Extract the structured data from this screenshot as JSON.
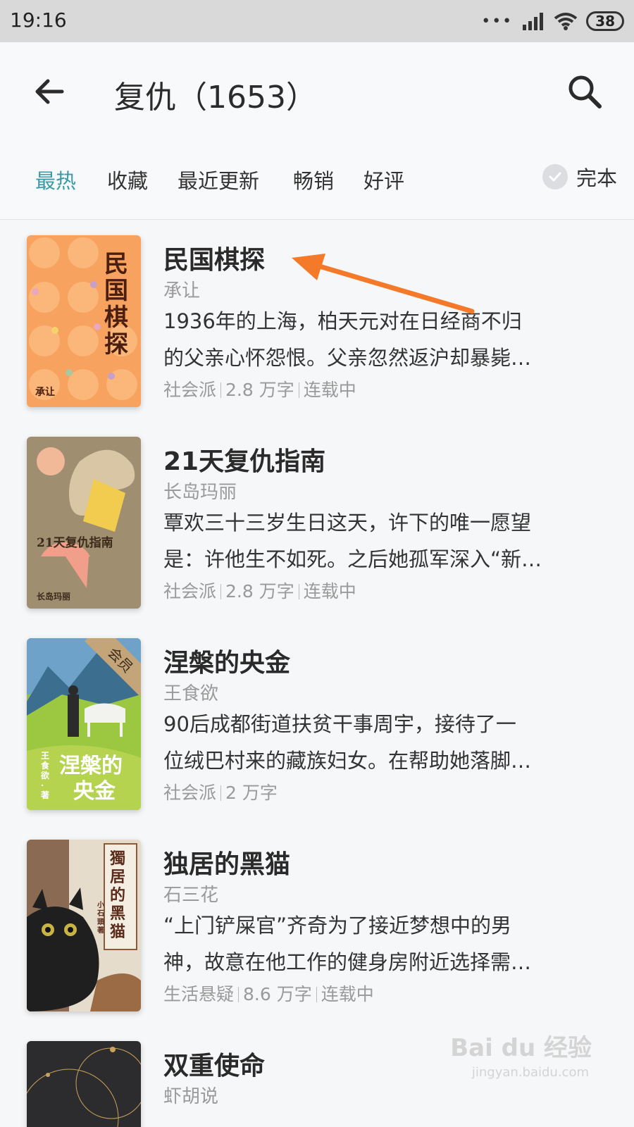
{
  "status_bar": {
    "time": "19:16",
    "battery": "38",
    "signal_icon": "signal-icon",
    "wifi_icon": "wifi-icon"
  },
  "header": {
    "title": "复仇（1653）",
    "back_icon": "back-arrow-icon",
    "search_icon": "search-icon"
  },
  "filters": {
    "tabs": [
      {
        "label": "最热",
        "active": true
      },
      {
        "label": "收藏",
        "active": false
      },
      {
        "label": "最近更新",
        "active": false
      },
      {
        "label": "畅销",
        "active": false
      },
      {
        "label": "好评",
        "active": false
      }
    ],
    "complete_label": "完本",
    "accent_color": "#3a9aa8"
  },
  "books": [
    {
      "title": "民国棋探",
      "author": "承让",
      "desc_line1": "1936年的上海，柏天元对在日经商不归",
      "desc_line2": "的父亲心怀怨恨。父亲忽然返沪却暴毙…",
      "genre": "社会派",
      "words": "2.8 万字",
      "status": "连载中",
      "cover_title": "民国棋探",
      "cover_author": "承让"
    },
    {
      "title": "21天复仇指南",
      "author": "长岛玛丽",
      "desc_line1": "覃欢三十三岁生日这天，许下的唯一愿望",
      "desc_line2": "是：许他生不如死。之后她孤军深入“新…",
      "genre": "社会派",
      "words": "2.8 万字",
      "status": "连载中",
      "cover_title": "21天复仇指南",
      "cover_author": "长岛玛丽"
    },
    {
      "title": "涅槃的央金",
      "author": "王食欲",
      "desc_line1": "90后成都街道扶贫干事周宇，接待了一",
      "desc_line2": "位绒巴村来的藏族妇女。在帮助她落脚…",
      "genre": "社会派",
      "words": "2 万字",
      "status": "",
      "cover_title_1": "涅槃的",
      "cover_title_2": "央金",
      "cover_author": "王食欲·著",
      "badge": "会员"
    },
    {
      "title": "独居的黑猫",
      "author": "石三花",
      "desc_line1": "“上门铲屎官”齐奇为了接近梦想中的男",
      "desc_line2": "神，故意在他工作的健身房附近选择需…",
      "genre": "生活悬疑",
      "words": "8.6 万字",
      "status": "连载中",
      "cover_title": "獨居的黑猫",
      "cover_author": "小石頭著"
    },
    {
      "title": "双重使命",
      "author": "虾胡说"
    }
  ],
  "watermark": {
    "text": "Bai du 经验",
    "sub": "jingyan.baidu.com"
  }
}
